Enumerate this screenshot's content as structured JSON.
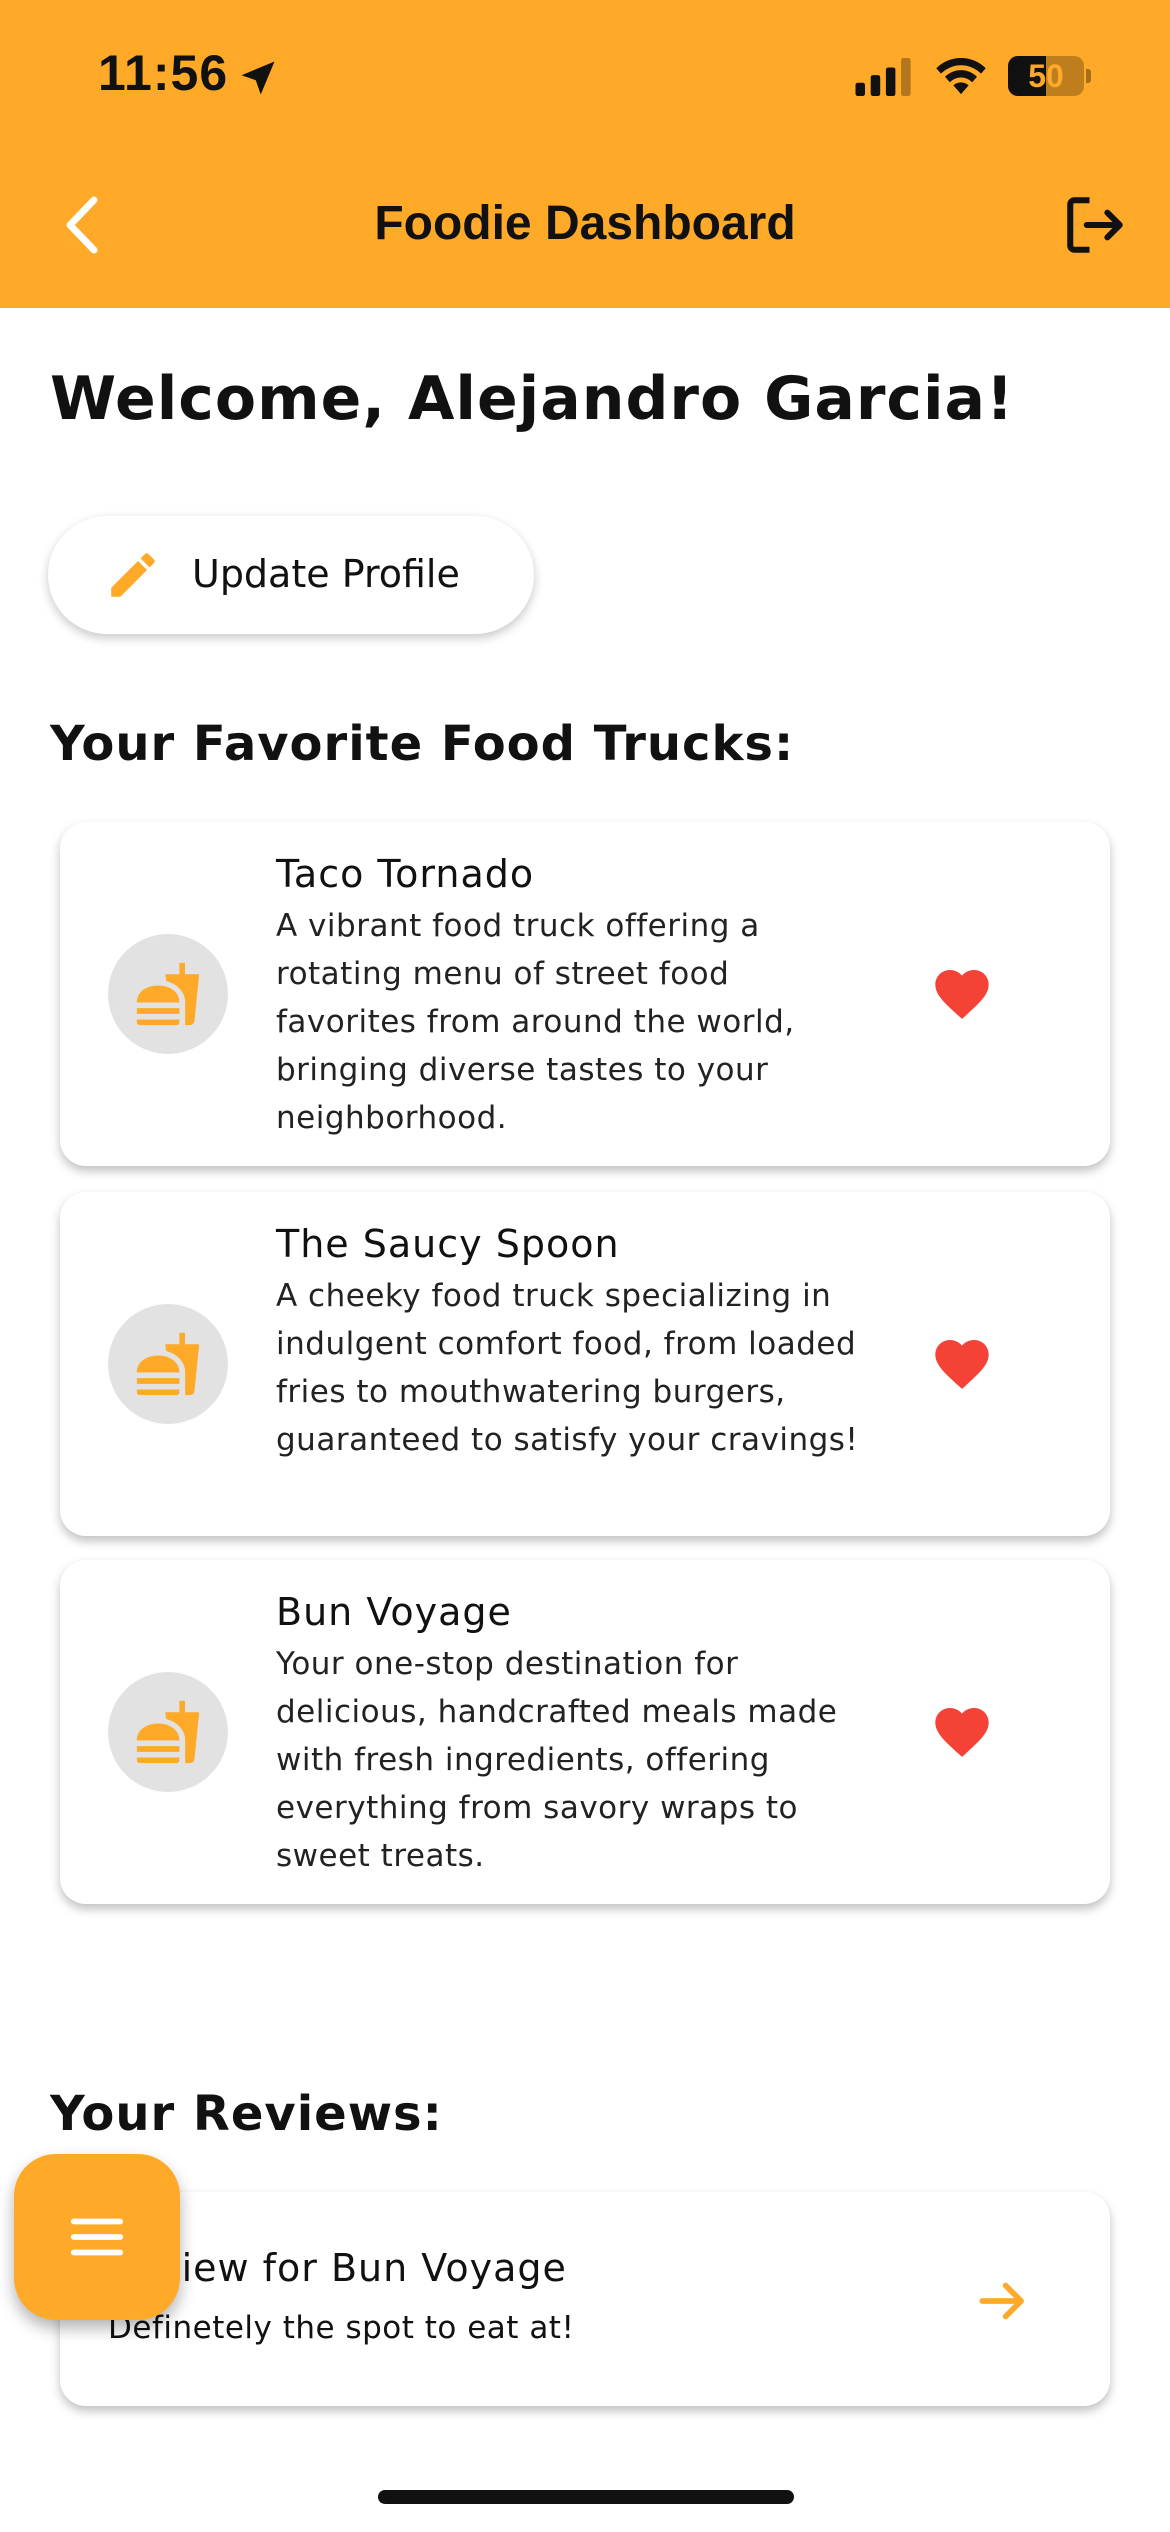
{
  "status_bar": {
    "time": "11:56",
    "battery": "50",
    "battery_level": 0.5
  },
  "header": {
    "title": "Foodie Dashboard"
  },
  "welcome": "Welcome, Alejandro Garcia!",
  "update_profile_label": "Update Profile",
  "favorites": {
    "title": "Your Favorite Food Trucks:",
    "items": [
      {
        "name": "Taco Tornado",
        "description": "A vibrant food truck offering a rotating menu of street food favorites from around the world, bringing diverse tastes to your neighborhood."
      },
      {
        "name": "The Saucy Spoon",
        "description": "A cheeky food truck specializing in indulgent comfort food, from loaded fries to mouthwatering burgers, guaranteed to satisfy your cravings!"
      },
      {
        "name": "Bun Voyage",
        "description": "Your one-stop destination for delicious, handcrafted meals made with fresh ingredients, offering everything from savory wraps to sweet treats."
      }
    ]
  },
  "reviews": {
    "title": "Your Reviews:",
    "items": [
      {
        "title": "Review for Bun Voyage",
        "text": "Definetely the spot to eat at!"
      }
    ]
  },
  "icons": {
    "back": "chevron-left-icon",
    "logout": "logout-icon",
    "edit": "pencil-icon",
    "truck": "fastfood-icon",
    "favorite": "heart-icon",
    "open_review": "arrow-right-icon",
    "menu": "menu-icon"
  },
  "colors": {
    "accent": "#FFA929",
    "heart": "#F44336",
    "avatar_bg": "#E2E2E2"
  }
}
